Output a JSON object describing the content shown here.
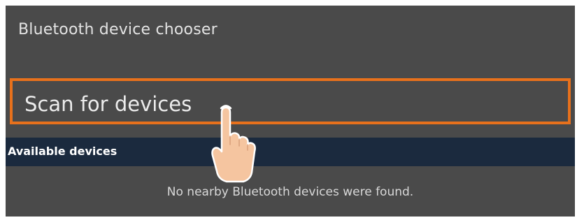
{
  "dialog": {
    "title": "Bluetooth device chooser"
  },
  "scan_button": {
    "label": "Scan for devices"
  },
  "available_section": {
    "header": "Available devices",
    "empty_message": "No nearby Bluetooth devices were found."
  },
  "colors": {
    "dialog_background": "#4a4a4a",
    "focus_border": "#e8711c",
    "section_header_background": "#1b2a3e",
    "hand_skin": "#f5c5a0"
  },
  "icons": {
    "tap_indicator": "tap-hand-icon"
  }
}
